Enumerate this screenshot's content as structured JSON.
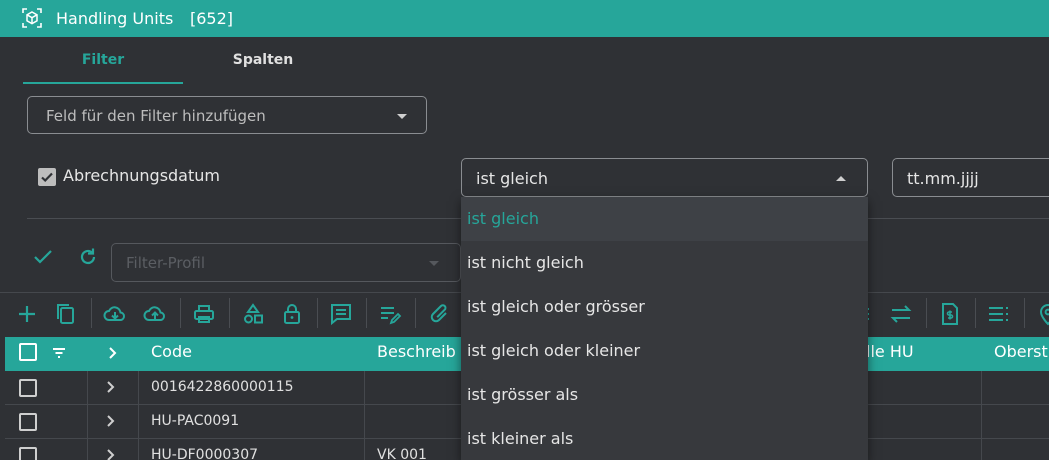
{
  "window": {
    "title": "Handling Units",
    "count": "[652]"
  },
  "tabs": [
    {
      "label": "Filter",
      "active": true
    },
    {
      "label": "Spalten",
      "active": false
    }
  ],
  "filter": {
    "add_field_label": "Feld für den Filter hinzufügen",
    "field_label": "Abrechnungsdatum",
    "field_checked": true,
    "operator_value": "ist gleich",
    "date_placeholder": "tt.mm.jjjj",
    "profile_placeholder": "Filter-Profil"
  },
  "operator_options": [
    {
      "label": "ist gleich",
      "selected": true
    },
    {
      "label": "ist nicht gleich",
      "selected": false
    },
    {
      "label": "ist gleich oder grösser",
      "selected": false
    },
    {
      "label": "ist gleich oder kleiner",
      "selected": false
    },
    {
      "label": "ist grösser als",
      "selected": false
    },
    {
      "label": "ist kleiner als",
      "selected": false
    }
  ],
  "table": {
    "headers": {
      "code": "Code",
      "description": "Beschreib",
      "parent_hu": "lle HU",
      "top": "Oberst"
    },
    "rows": [
      {
        "code": "0016422860000115",
        "description": ""
      },
      {
        "code": "HU-PAC0091",
        "description": ""
      },
      {
        "code": "HU-DF0000307",
        "description": "VK 001"
      }
    ]
  },
  "colors": {
    "accent": "#26a69a",
    "background": "#2f3135",
    "dropdown": "#37393d"
  }
}
